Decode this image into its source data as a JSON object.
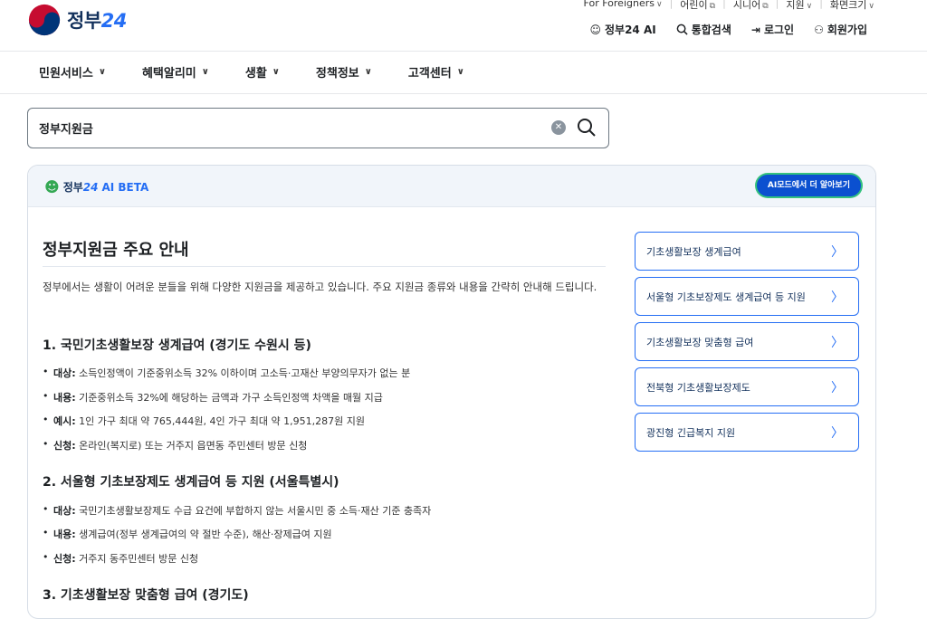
{
  "header": {
    "logo_text_ko": "정부",
    "logo_text_num": "24",
    "util_links": [
      "For Foreigners",
      "어린이",
      "시니어",
      "지원",
      "화면크기"
    ],
    "utility": [
      {
        "label": "정부24 AI",
        "icon": "ai-mascot-icon"
      },
      {
        "label": "통합검색",
        "icon": "search-icon"
      },
      {
        "label": "로그인",
        "icon": "login-icon"
      },
      {
        "label": "회원가입",
        "icon": "person-add-icon"
      }
    ]
  },
  "gnb": [
    "민원서비스",
    "혜택알리미",
    "생활",
    "정책정보",
    "고객센터"
  ],
  "search": {
    "value": "정부지원금"
  },
  "ai_card": {
    "brand_ko": "정부",
    "brand_num": "24",
    "ai_label": "AI BETA",
    "mode_button": "AI모드에서 더 알아보기",
    "title": "정부지원금 주요 안내",
    "intro": "정부에서는 생활이 어려운 분들을 위해 다양한 지원금을 제공하고 있습니다. 주요 지원금 종류와 내용을 간략히 안내해 드립니다.",
    "sections": [
      {
        "heading": "1. 국민기초생활보장 생계급여 (경기도 수원시 등)",
        "items": [
          {
            "key": "대상:",
            "text": " 소득인정액이 기준중위소득 32% 이하이며 고소득·고재산 부양의무자가 없는 분"
          },
          {
            "key": "내용:",
            "text": " 기준중위소득 32%에 해당하는 금액과 가구 소득인정액 차액을 매월 지급"
          },
          {
            "key": "예시:",
            "text": " 1인 가구 최대 약 765,444원, 4인 가구 최대 약 1,951,287원 지원"
          },
          {
            "key": "신청:",
            "text": " 온라인(복지로) 또는 거주지 읍면동 주민센터 방문 신청"
          }
        ]
      },
      {
        "heading": "2. 서울형 기초보장제도 생계급여 등 지원 (서울특별시)",
        "items": [
          {
            "key": "대상:",
            "text": " 국민기초생활보장제도 수급 요건에 부합하지 않는 서울시민 중 소득·재산 기준 충족자"
          },
          {
            "key": "내용:",
            "text": " 생계급여(정부 생계급여의 약 절반 수준), 해산·장제급여 지원"
          },
          {
            "key": "신청:",
            "text": " 거주지 동주민센터 방문 신청"
          }
        ]
      },
      {
        "heading": "3. 기초생활보장 맞춤형 급여 (경기도)",
        "items": []
      }
    ],
    "related": [
      "기초생활보장 생계급여",
      "서울형 기초보장제도 생계급여 등 지원",
      "기초생활보장 맞춤형 급여",
      "전북형 기초생활보장제도",
      "광진형 긴급복지 지원"
    ]
  }
}
